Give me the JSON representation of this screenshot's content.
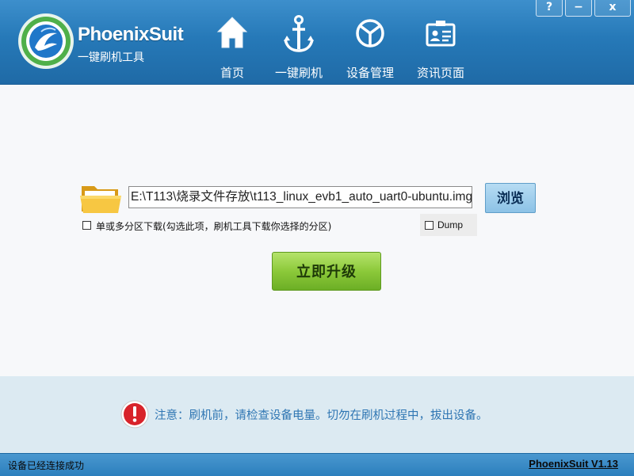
{
  "window": {
    "help_label": "?",
    "minimize_label": "−",
    "close_label": "x"
  },
  "header": {
    "brand": "PhoenixSuit",
    "subtitle": "一键刷机工具",
    "nav": [
      {
        "label": "首页",
        "icon": "house-icon"
      },
      {
        "label": "一键刷机",
        "icon": "anchor-icon"
      },
      {
        "label": "设备管理",
        "icon": "device-icon"
      },
      {
        "label": "资讯页面",
        "icon": "news-card-icon"
      }
    ],
    "active_nav": "一键刷机"
  },
  "main": {
    "path_value": "E:\\T113\\烧录文件存放\\t113_linux_evb1_auto_uart0-ubuntu.img",
    "browse_label": "浏览",
    "partition_checkbox_label": "单或多分区下载(勾选此项，刷机工具下载你选择的分区)",
    "partition_checked": false,
    "dump_label": "Dump",
    "dump_checked": false,
    "upgrade_label": "立即升级"
  },
  "notice": {
    "text": "注意：刷机前，请检查设备电量。切勿在刷机过程中，拔出设备。"
  },
  "status": {
    "left": "设备已经连接成功",
    "right": "PhoenixSuit V1.13"
  },
  "colors": {
    "header_blue": "#2679b8",
    "upgrade_green": "#8cc93a",
    "notice_text": "#2f76b3",
    "warning_red": "#d8232a"
  }
}
